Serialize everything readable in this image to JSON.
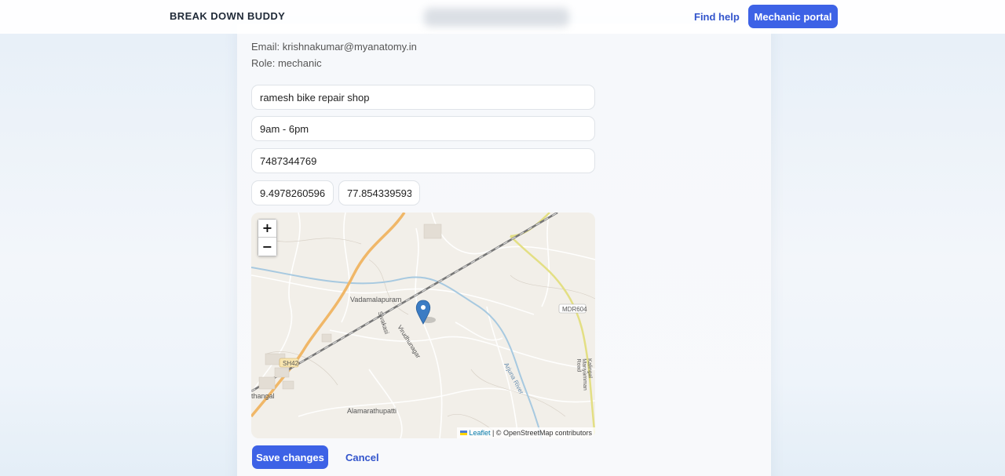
{
  "navbar": {
    "brand": "BREAK DOWN BUDDY",
    "find_help": "Find help",
    "mechanic_portal": "Mechanic portal"
  },
  "profile": {
    "email_line": "Email: krishnakumar@myanatomy.in",
    "role_line": "Role: mechanic"
  },
  "form": {
    "shop_name": "ramesh bike repair shop",
    "hours": "9am - 6pm",
    "phone": "7487344769",
    "latitude": "9.497826059631",
    "longitude": "77.854339593324"
  },
  "map": {
    "zoom_in": "+",
    "zoom_out": "−",
    "labels": {
      "vadamalapuram": "Vadamalapuram",
      "mdr604": "MDR604",
      "sh42": "SH42",
      "thangal": "thangal",
      "alamarathupatti": "Alamarathupatti",
      "sivakasi": "Sivakasi",
      "virudhunagar": "Virudhunagar",
      "arjuna_river": "Arjuna River",
      "kalingal_road": "Kalingal Mariyamman Road"
    },
    "attribution_leaflet": "Leaflet",
    "attribution_rest": " | © OpenStreetMap contributors",
    "accent_marker": "#3b7cc4"
  },
  "actions": {
    "save": "Save changes",
    "cancel": "Cancel"
  },
  "colors": {
    "primary": "#3d62e6",
    "link": "#3355cc"
  }
}
